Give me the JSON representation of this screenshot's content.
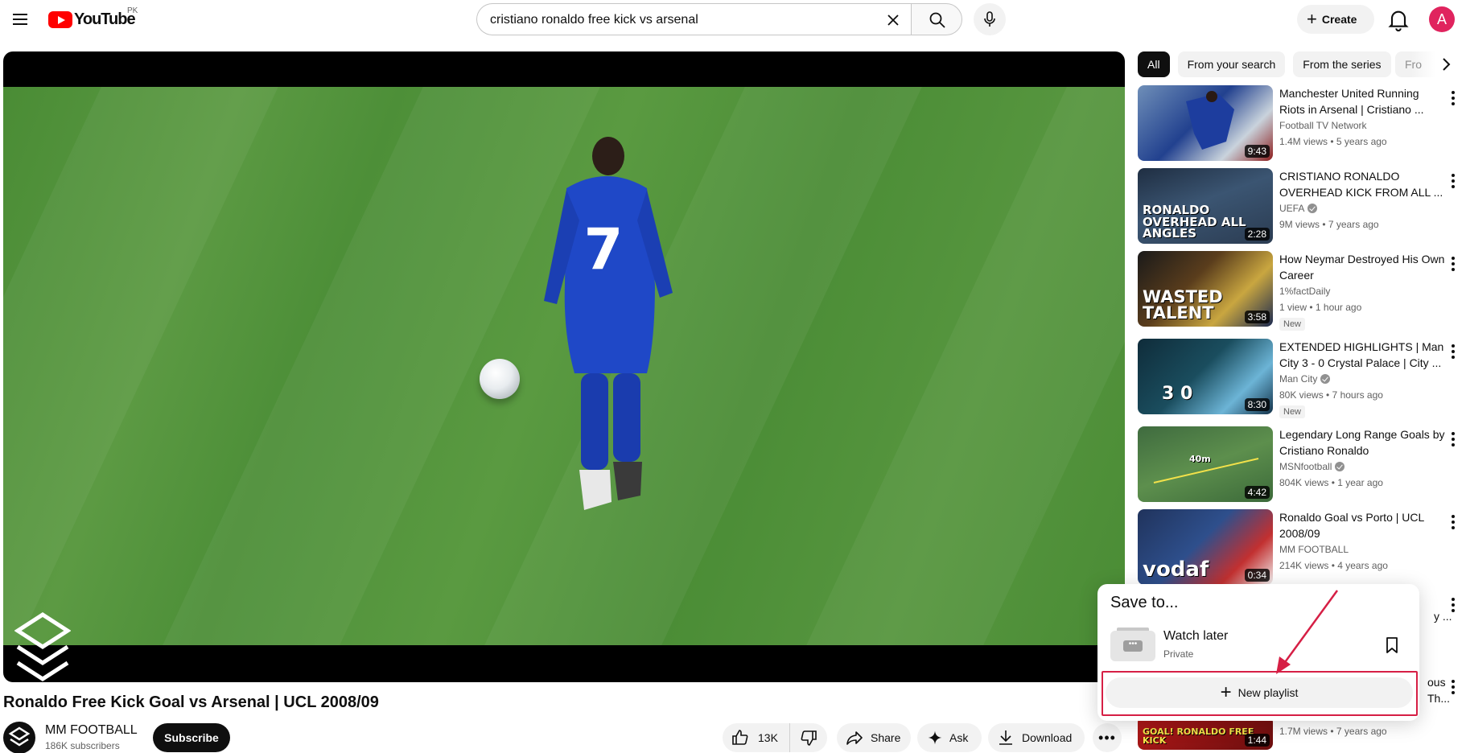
{
  "header": {
    "logo_text": "YouTube",
    "country_code": "PK",
    "search_value": "cristiano ronaldo free kick vs arsenal",
    "create_label": "Create",
    "avatar_letter": "A"
  },
  "video": {
    "title": "Ronaldo Free Kick Goal vs Arsenal | UCL 2008/09",
    "jersey_number": "7",
    "channel_name": "MM FOOTBALL",
    "subscribers": "186K subscribers",
    "subscribe_label": "Subscribe",
    "likes": "13K",
    "share_label": "Share",
    "ask_label": "Ask",
    "download_label": "Download",
    "more_label": "•••"
  },
  "chips": [
    {
      "label": "All",
      "active": true
    },
    {
      "label": "From your search",
      "active": false
    },
    {
      "label": "From the series",
      "active": false
    }
  ],
  "chip_cut_label": "Fro",
  "recommendations": [
    {
      "title": "Manchester United Running Riots in Arsenal | Cristiano ...",
      "channel": "Football TV Network",
      "verified": false,
      "meta": "1.4M views • 5 years ago",
      "duration": "9:43",
      "badge": "",
      "thumb_label": ""
    },
    {
      "title": "CRISTIANO RONALDO OVERHEAD KICK FROM ALL ...",
      "channel": "UEFA",
      "verified": true,
      "meta": "9M views • 7 years ago",
      "duration": "2:28",
      "badge": "",
      "thumb_label": "RONALDO OVERHEAD ALL ANGLES"
    },
    {
      "title": "How Neymar Destroyed His Own Career",
      "channel": "1%factDaily",
      "verified": false,
      "meta": "1 view • 1 hour ago",
      "duration": "3:58",
      "badge": "New",
      "thumb_label": "WASTED TALENT"
    },
    {
      "title": "EXTENDED HIGHLIGHTS | Man City 3 - 0 Crystal Palace | City ...",
      "channel": "Man City",
      "verified": true,
      "meta": "80K views • 7 hours ago",
      "duration": "8:30",
      "badge": "New",
      "thumb_label": "3 0"
    },
    {
      "title": "Legendary Long Range Goals by Cristiano Ronaldo",
      "channel": "MSNfootball",
      "verified": true,
      "meta": "804K views • 1 year ago",
      "duration": "4:42",
      "badge": "",
      "thumb_label": "40m"
    },
    {
      "title": "Ronaldo Goal vs Porto | UCL 2008/09",
      "channel": "MM FOOTBALL",
      "verified": false,
      "meta": "214K views • 4 years ago",
      "duration": "0:34",
      "badge": "",
      "thumb_label": "vodaf"
    },
    {
      "title": "",
      "channel": "",
      "verified": false,
      "meta": "1.7M views • 7 years ago",
      "duration": "1:44",
      "badge": "",
      "thumb_label": "GOAL! RONALDO FREE KICK"
    }
  ],
  "partial_titles": {
    "row7_tail": "y ...",
    "row8_line1": "ous",
    "row8_line2": "Th..."
  },
  "save_popup": {
    "title": "Save to...",
    "items": [
      {
        "name": "Watch later",
        "privacy": "Private"
      }
    ],
    "new_playlist_label": "New playlist"
  },
  "colors": {
    "brand_red": "#ff0000",
    "highlight": "#d61f45",
    "avatar_bg": "#e0245e"
  }
}
